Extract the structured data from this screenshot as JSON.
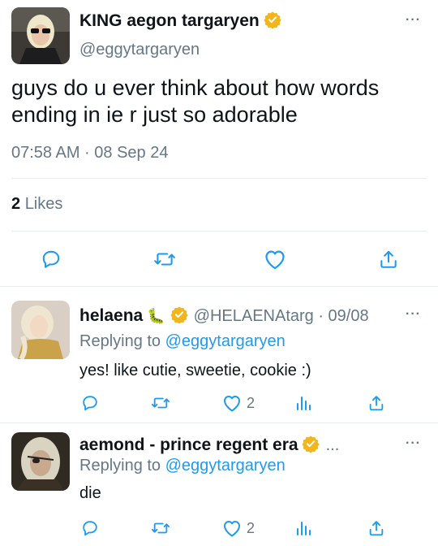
{
  "main_tweet": {
    "display_name": "KING aegon targaryen",
    "handle": "@eggytargaryen",
    "text": "guys do u ever think about how words ending in ie r just so adorable",
    "timestamp": "07:58 AM · 08 Sep 24",
    "likes_count": "2",
    "likes_label": "Likes",
    "more_label": "···"
  },
  "replies": [
    {
      "display_name": "helaena",
      "emoji": "🐛",
      "handle_date": "@HELAENAtarg · 09/08",
      "replying_prefix": "Replying to",
      "replying_handle": "@eggytargaryen",
      "text": "yes! like cutie, sweetie, cookie :)",
      "like_count": "2",
      "more_label": "···"
    },
    {
      "display_name": "aemond - prince regent era",
      "ellipsis": "...",
      "replying_prefix": "Replying to",
      "replying_handle": "@eggytargaryen",
      "text": "die",
      "like_count": "2",
      "more_label": "···"
    }
  ],
  "colors": {
    "accent": "#1d9bf0",
    "verified": "#f2b51b",
    "muted": "#657786",
    "divider": "#e6ecf0"
  }
}
